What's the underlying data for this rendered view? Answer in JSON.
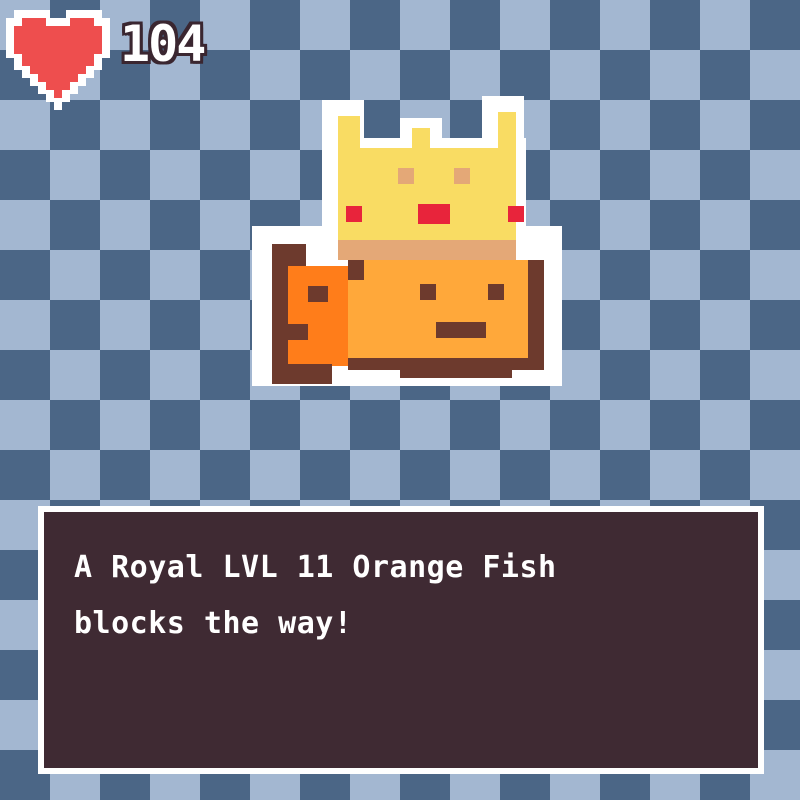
{
  "hud": {
    "hp_icon": "heart-icon",
    "hp_value": "104",
    "colors": {
      "heart": "#ee4e4e",
      "text": "#ffffff",
      "outline": "#3a2630"
    }
  },
  "enemy": {
    "icon": "royal-orange-fish-sprite",
    "colors": {
      "crown": "#f9dc63",
      "crown_band": "#e4a877",
      "gem": "#e8243b",
      "body": "#ffa83a",
      "fin": "#ff7d1a",
      "outline": "#6d3a2d"
    }
  },
  "dialog": {
    "lines": [
      "A Royal LVL 11 Orange Fish",
      "blocks the way!"
    ],
    "colors": {
      "background": "#3f2a33",
      "border": "#ffffff",
      "text": "#ffffff"
    }
  },
  "background": {
    "colors": {
      "light": "#a3b7d1",
      "dark": "#4b6686"
    }
  }
}
